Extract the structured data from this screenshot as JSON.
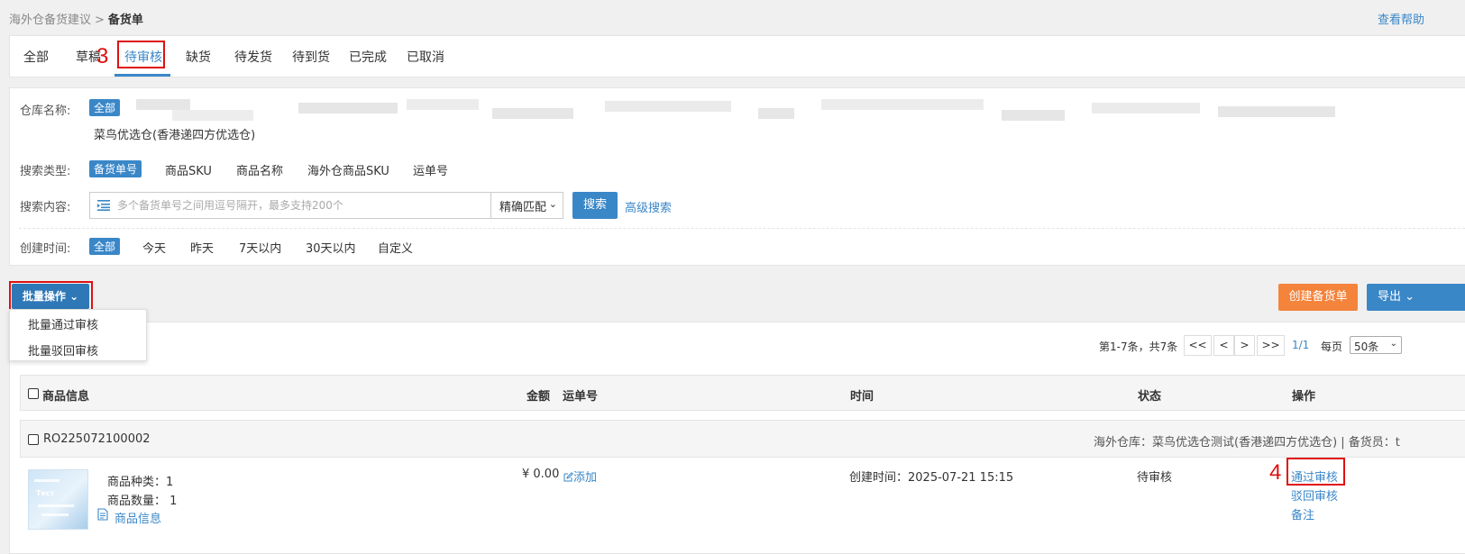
{
  "breadcrumb": {
    "parent": "海外仓备货建议",
    "separator": ">",
    "current": "备货单"
  },
  "help_link": "查看帮助",
  "tabs": [
    {
      "label": "全部"
    },
    {
      "label": "草稿"
    },
    {
      "label": "待审核",
      "active": true
    },
    {
      "label": "缺货"
    },
    {
      "label": "待发货"
    },
    {
      "label": "待到货"
    },
    {
      "label": "已完成"
    },
    {
      "label": "已取消"
    }
  ],
  "annotations": {
    "step3": "3",
    "step4": "4"
  },
  "filters": {
    "warehouse": {
      "label": "仓库名称:",
      "selected": "全部",
      "option": "菜鸟优选仓(香港递四方优选仓)"
    },
    "search_type": {
      "label": "搜索类型:",
      "options": [
        "备货单号",
        "商品SKU",
        "商品名称",
        "海外仓商品SKU",
        "运单号"
      ]
    },
    "search_content": {
      "label": "搜索内容:",
      "placeholder": "多个备货单号之间用逗号隔开，最多支持200个",
      "match_mode": "精确匹配",
      "search_button": "搜索",
      "advanced_link": "高级搜索"
    },
    "created_time": {
      "label": "创建时间:",
      "options": [
        "全部",
        "今天",
        "昨天",
        "7天以内",
        "30天以内",
        "自定义"
      ]
    }
  },
  "toolbar": {
    "batch_label": "批量操作",
    "batch_menu": [
      "批量通过审核",
      "批量驳回审核"
    ],
    "create_label": "创建备货单",
    "export_label": "导出"
  },
  "pager": {
    "info": "第1-7条，共7条",
    "first": "<<",
    "prev": "<",
    "next": ">",
    "last": ">>",
    "page": "1/1",
    "per_label": "每页",
    "per_value": "50条"
  },
  "table": {
    "headers": {
      "product": "商品信息",
      "amount": "金额",
      "tracking": "运单号",
      "time": "时间",
      "status": "状态",
      "actions": "操作"
    }
  },
  "order": {
    "number": "RO225072100002",
    "meta": "海外仓库：菜鸟优选仓测试(香港递四方优选仓) | 备货员：t",
    "thumb_text": "Тест",
    "kinds": "商品种类：1",
    "qty": "商品数量：  1",
    "product_info_link": "商品信息",
    "amount": "¥  0.00",
    "tracking_add": "添加",
    "created": "创建时间：2025-07-21 15:15",
    "status": "待审核",
    "actions": {
      "approve": "通过审核",
      "reject": "驳回审核",
      "remark": "备注"
    }
  },
  "colors": {
    "primary": "#3a87c8",
    "orange": "#f4833b",
    "annotation": "#e01010"
  }
}
